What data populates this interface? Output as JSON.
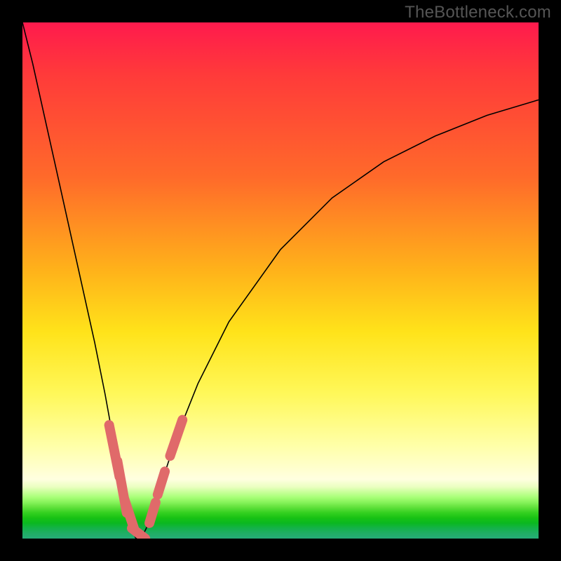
{
  "watermark": "TheBottleneck.com",
  "chart_data": {
    "type": "line",
    "title": "",
    "xlabel": "",
    "ylabel": "",
    "xlim": [
      0,
      100
    ],
    "ylim": [
      0,
      100
    ],
    "series": [
      {
        "name": "bottleneck-curve",
        "x": [
          0,
          2,
          4,
          6,
          8,
          10,
          12,
          14,
          16,
          18,
          19,
          20,
          21,
          22,
          23,
          24,
          25,
          26,
          28,
          30,
          34,
          40,
          50,
          60,
          70,
          80,
          90,
          100
        ],
        "y": [
          100,
          92,
          83,
          74,
          65,
          56,
          47,
          38,
          28,
          17,
          11,
          6,
          2,
          0,
          0,
          2,
          5,
          8,
          14,
          20,
          30,
          42,
          56,
          66,
          73,
          78,
          82,
          85
        ]
      }
    ],
    "markers": {
      "name": "highlighted-segments",
      "color": "#e06a6a",
      "segments": [
        {
          "x": [
            16.8,
            18.8
          ],
          "y": [
            22,
            12
          ]
        },
        {
          "x": [
            18.4,
            20.2
          ],
          "y": [
            15,
            5
          ]
        },
        {
          "x": [
            19.8,
            21.6
          ],
          "y": [
            7.5,
            2
          ]
        },
        {
          "x": [
            21.2,
            23.8
          ],
          "y": [
            2,
            0
          ]
        },
        {
          "x": [
            24.6,
            25.8
          ],
          "y": [
            3,
            7
          ]
        },
        {
          "x": [
            26.2,
            27.6
          ],
          "y": [
            8.5,
            13
          ]
        },
        {
          "x": [
            28.6,
            31.0
          ],
          "y": [
            16,
            23
          ]
        }
      ]
    }
  }
}
